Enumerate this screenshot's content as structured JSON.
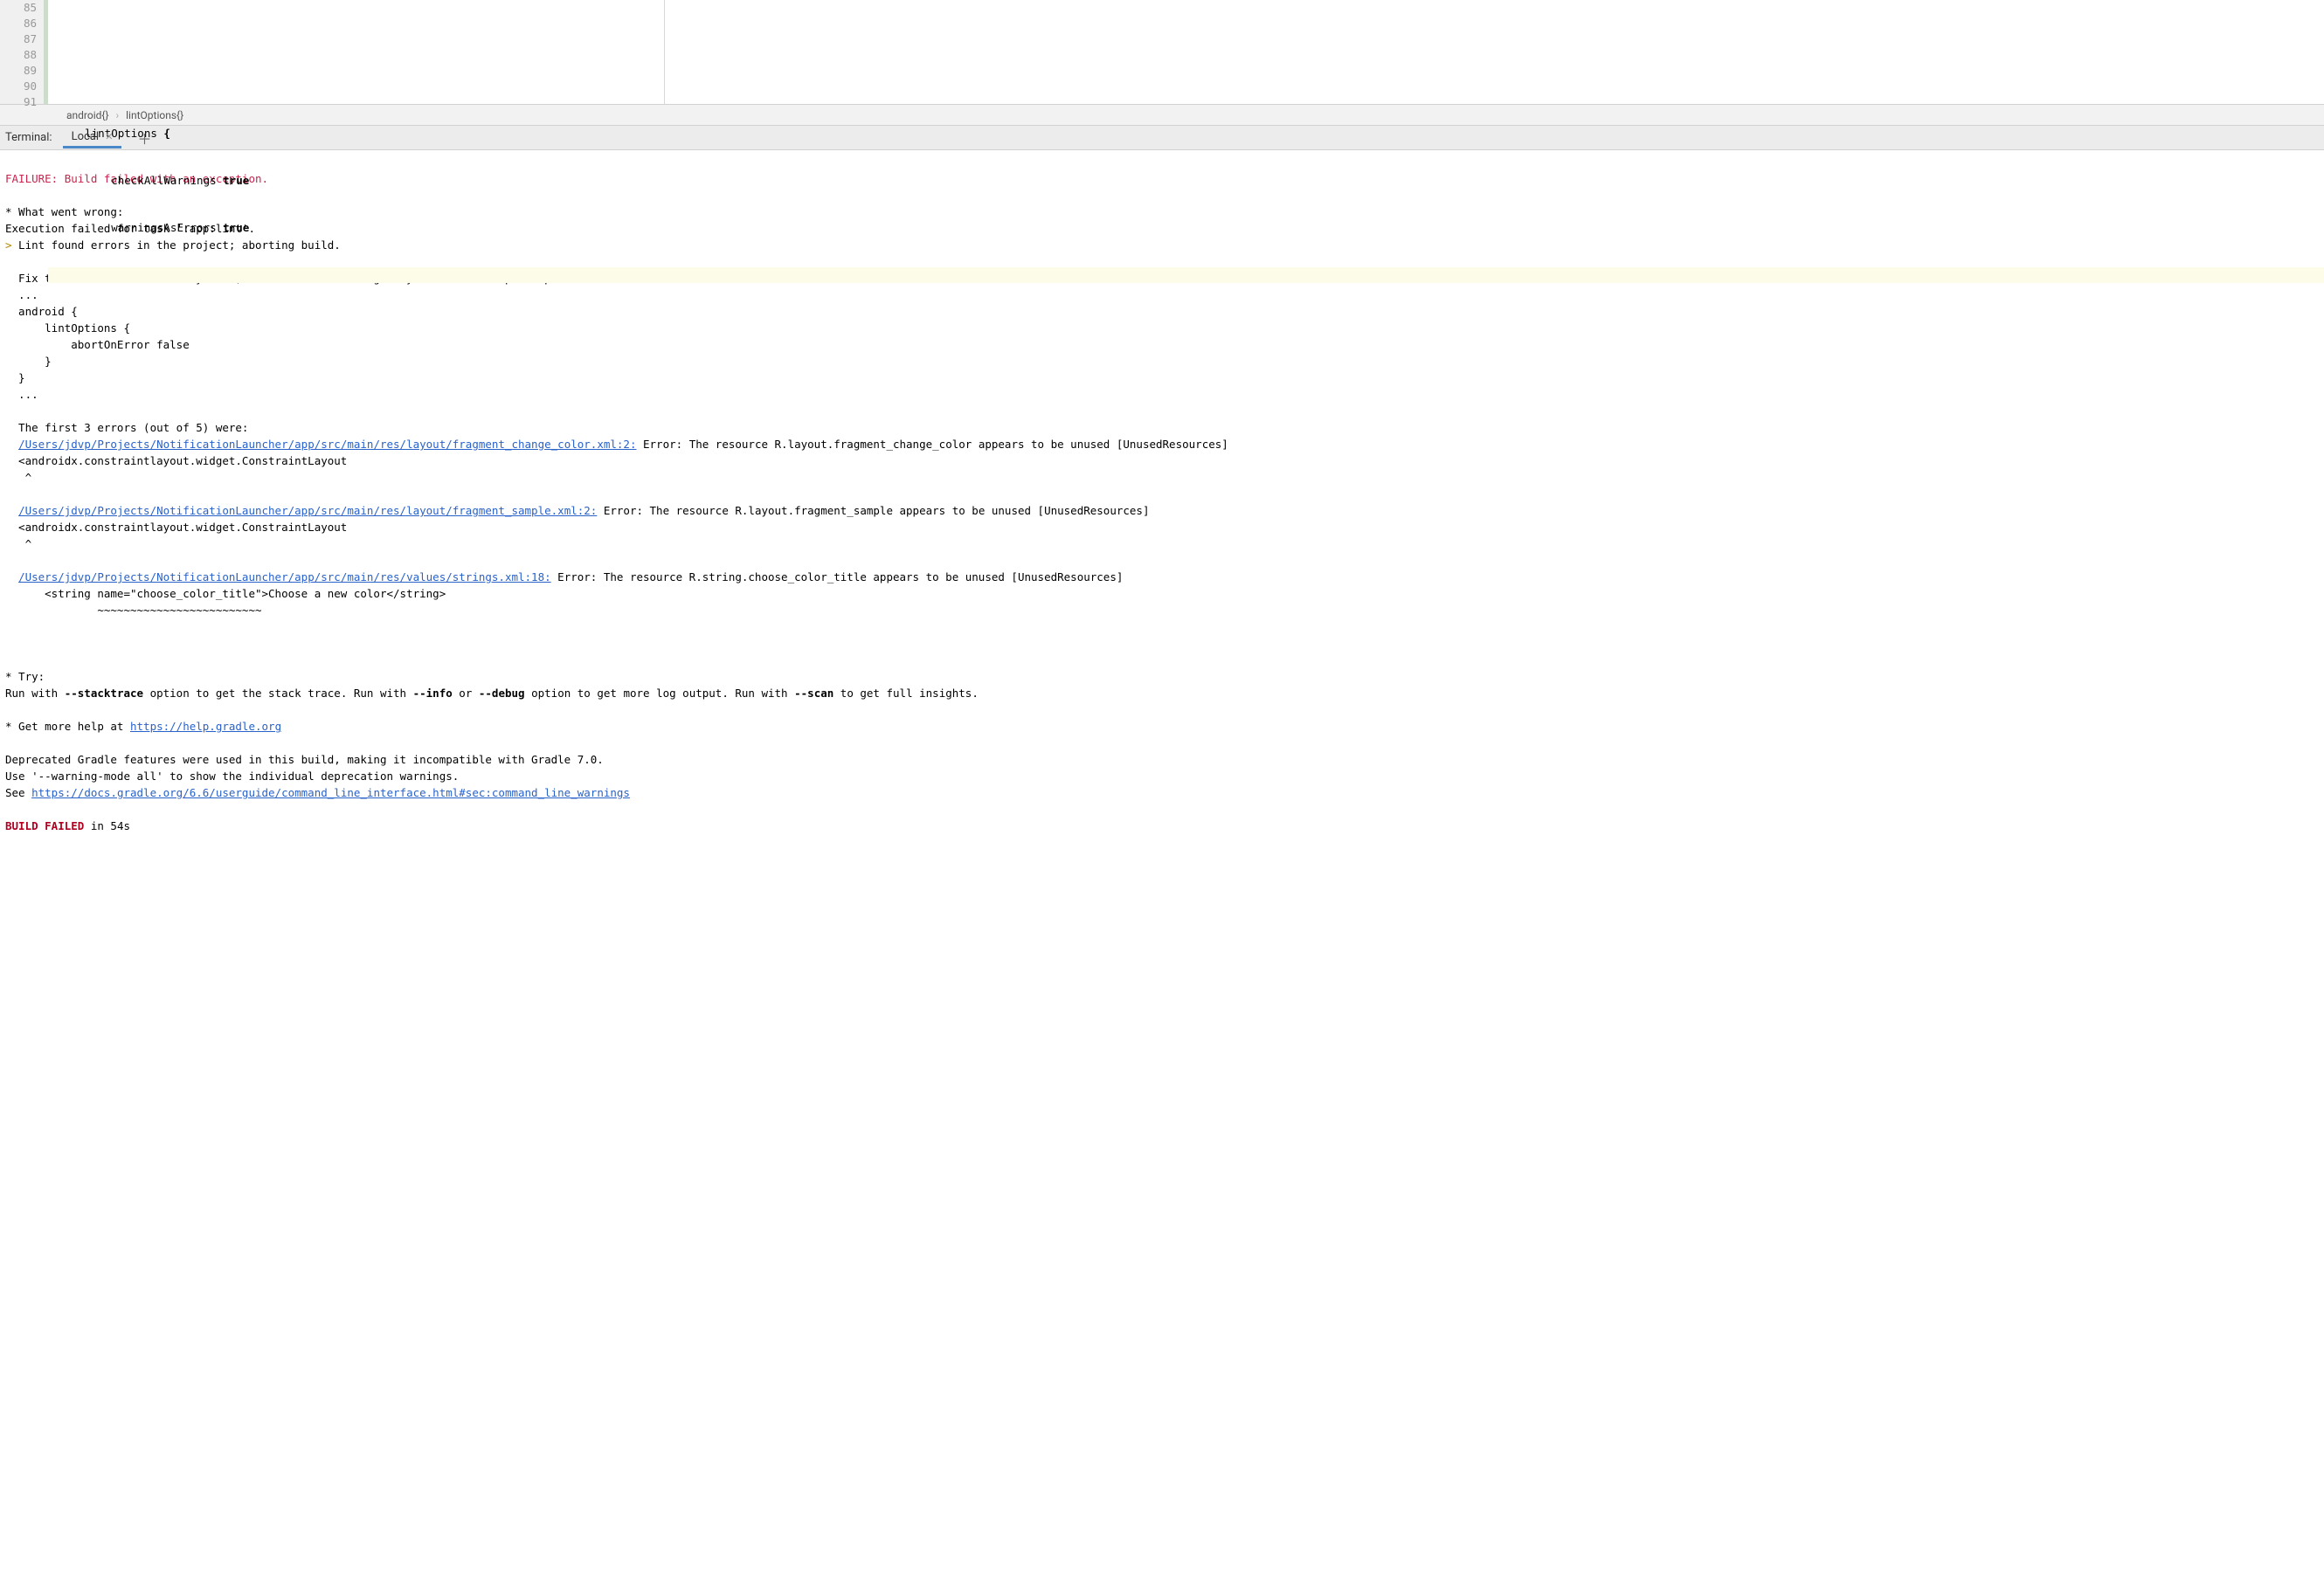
{
  "editor": {
    "gutter_start": 85,
    "lines": [
      {
        "num": 85,
        "text": ""
      },
      {
        "num": 86,
        "text": ""
      },
      {
        "num": 87,
        "text_pre": "    lintOptions ",
        "text_bold": "{",
        "text_post": ""
      },
      {
        "num": 88,
        "text_pre": "        checkAllWarnings ",
        "text_bold": "true",
        "text_post": ""
      },
      {
        "num": 89,
        "text_pre": "        warningsAsErrors ",
        "text_bold": "true",
        "text_post": ""
      },
      {
        "num": 90,
        "text": "",
        "highlighted": true
      },
      {
        "num": 91,
        "text": ""
      }
    ]
  },
  "breadcrumb": {
    "items": [
      "android{}",
      "lintOptions{}"
    ]
  },
  "terminal": {
    "label": "Terminal:",
    "tab": "Local",
    "output": {
      "failure_line": "FAILURE: Build failed with an exception.",
      "what_wrong_header": "* What went wrong:",
      "exec_failed": "Execution failed for task ':app:lint'.",
      "lint_found_marker": ">",
      "lint_found": " Lint found errors in the project; aborting build.",
      "fix_text": "  Fix the issues identified by lint, or add the following to your build script to proceed with errors:",
      "dots1": "  ...",
      "android_open": "  android {",
      "lintopt_open": "      lintOptions {",
      "abort_line": "          abortOnError false",
      "lintopt_close": "      }",
      "android_close": "  }",
      "dots2": "  ...",
      "first3": "  The first 3 errors (out of 5) were:",
      "err1_link": "/Users/jdvp/Projects/NotificationLauncher/app/src/main/res/layout/fragment_change_color.xml:2:",
      "err1_msg": " Error: The resource R.layout.fragment_change_color appears to be unused [UnusedResources]",
      "err1_snippet": "  <androidx.constraintlayout.widget.ConstraintLayout",
      "err1_caret": "   ^",
      "err2_link": "/Users/jdvp/Projects/NotificationLauncher/app/src/main/res/layout/fragment_sample.xml:2:",
      "err2_msg": " Error: The resource R.layout.fragment_sample appears to be unused [UnusedResources]",
      "err2_snippet": "  <androidx.constraintlayout.widget.ConstraintLayout",
      "err2_caret": "   ^",
      "err3_link": "/Users/jdvp/Projects/NotificationLauncher/app/src/main/res/values/strings.xml:18:",
      "err3_msg": " Error: The resource R.string.choose_color_title appears to be unused [UnusedResources]",
      "err3_snippet": "      <string name=\"choose_color_title\">Choose a new color</string>",
      "err3_tilde": "              ~~~~~~~~~~~~~~~~~~~~~~~~~",
      "try_header": "* Try:",
      "try_pre1": "Run with ",
      "try_flag1": "--stacktrace",
      "try_mid1": " option to get the stack trace. Run with ",
      "try_flag2": "--info",
      "try_mid2": " or ",
      "try_flag3": "--debug",
      "try_mid3": " option to get more log output. Run with ",
      "try_flag4": "--scan",
      "try_post": " to get full insights.",
      "help_pre": "* Get more help at ",
      "help_link": "https://help.gradle.org",
      "deprecated1": "Deprecated Gradle features were used in this build, making it incompatible with Gradle 7.0.",
      "deprecated2": "Use '--warning-mode all' to show the individual deprecation warnings.",
      "see_pre": "See ",
      "see_link": "https://docs.gradle.org/6.6/userguide/command_line_interface.html#sec:command_line_warnings",
      "build_failed": "BUILD FAILED",
      "build_time": " in 54s"
    }
  }
}
